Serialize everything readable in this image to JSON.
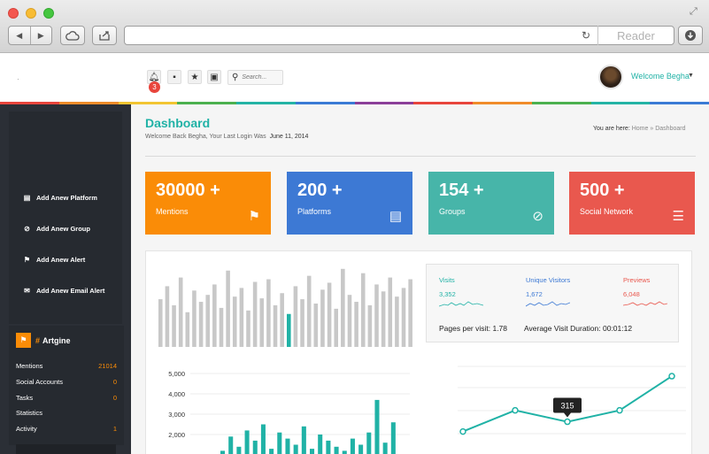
{
  "browser": {
    "reader_label": "Reader",
    "url": ""
  },
  "header": {
    "notification_count": "3",
    "search_placeholder": "Search...",
    "welcome_text": "Welcome Begha"
  },
  "colors": {
    "teal": "#20b2a6",
    "orange": "#fa8c07",
    "blue": "#3d79d4",
    "green": "#47b5a9",
    "red": "#e9584e",
    "purple": "#8f3a8c",
    "rainbow": [
      "#e8453c",
      "#f08c2a",
      "#f2c532",
      "#4cb14f",
      "#24b4a5",
      "#3a7bd5",
      "#8b3f99",
      "#e8453c",
      "#f08c2a",
      "#4cb14f",
      "#24b4a5",
      "#3a7bd5"
    ]
  },
  "sidebar": {
    "buttons": [
      {
        "label": "Add Anew Platform",
        "icon": "document-icon",
        "color": "#3d79d4"
      },
      {
        "label": "Add Anew Group",
        "icon": "paperclip-icon",
        "color": "#20b2a6"
      },
      {
        "label": "Add Anew Alert",
        "icon": "flag-icon",
        "color": "#fa8c07"
      },
      {
        "label": "Add Anew Email Alert",
        "icon": "envelope-icon",
        "color": "#8f3a8c"
      }
    ],
    "panel_title": "Artgine",
    "panel_hash": "#",
    "stats": [
      {
        "label": "Mentions",
        "value": "21014"
      },
      {
        "label": "Social Accounts",
        "value": "0"
      },
      {
        "label": "Tasks",
        "value": "0"
      },
      {
        "label": "Statistics",
        "value": ""
      },
      {
        "label": "Activity",
        "value": "1"
      }
    ]
  },
  "main": {
    "title": "Dashboard",
    "subtitle": "Welcome Back Begha, Your Last Login Was",
    "last_login": "June 11, 2014",
    "breadcrumb": {
      "prefix": "You are here:",
      "home": "Home",
      "sep": "»",
      "current": "Dashboard"
    },
    "cards": [
      {
        "number": "30000 +",
        "label": "Mentions",
        "icon": "flag-icon",
        "color": "#fa8c07"
      },
      {
        "number": "200 +",
        "label": "Platforms",
        "icon": "document-icon",
        "color": "#3d79d4"
      },
      {
        "number": "154 +",
        "label": "Groups",
        "icon": "paperclip-icon",
        "color": "#47b5a9"
      },
      {
        "number": "500 +",
        "label": "Social Network",
        "icon": "router-icon",
        "color": "#e9584e"
      }
    ],
    "stats_box": {
      "visits_label": "Visits",
      "visits_value": "3,352",
      "unique_label": "Unique Visitors",
      "unique_value": "1,672",
      "previews_label": "Previews",
      "previews_value": "6,048",
      "pages_per_visit": "Pages per visit:  1.78",
      "avg_duration": "Average Visit Duration:  00:01:12"
    }
  },
  "chart_data": [
    {
      "type": "bar",
      "values": [
        55,
        70,
        48,
        80,
        40,
        65,
        52,
        60,
        72,
        45,
        88,
        58,
        68,
        42,
        75,
        56,
        78,
        48,
        62,
        38,
        70,
        55,
        82,
        50,
        66,
        74,
        44,
        90,
        60,
        52,
        85,
        48,
        72,
        64,
        80,
        58,
        68,
        78
      ],
      "highlight_index": 19,
      "ylim": [
        0,
        100
      ]
    },
    {
      "type": "bar",
      "yticks": [
        5000,
        4000,
        3000,
        2000
      ],
      "ytick_labels": [
        "5,000",
        "4,000",
        "3,000",
        "2,000"
      ],
      "ylim": [
        1000,
        5000
      ],
      "values": [
        1200,
        1900,
        1400,
        2200,
        1700,
        2500,
        1300,
        2100,
        1800,
        1500,
        2400,
        1300,
        2000,
        1700,
        1400,
        1200,
        1800,
        1500,
        2100,
        3700,
        1600,
        2600
      ],
      "color": "#20b2a6"
    },
    {
      "type": "line",
      "values": [
        1,
        2.3,
        1.6,
        2.3,
        4.4
      ],
      "ylim": [
        0,
        5
      ],
      "tooltip": {
        "index": 2,
        "label": "315"
      },
      "color": "#20b2a6"
    }
  ]
}
